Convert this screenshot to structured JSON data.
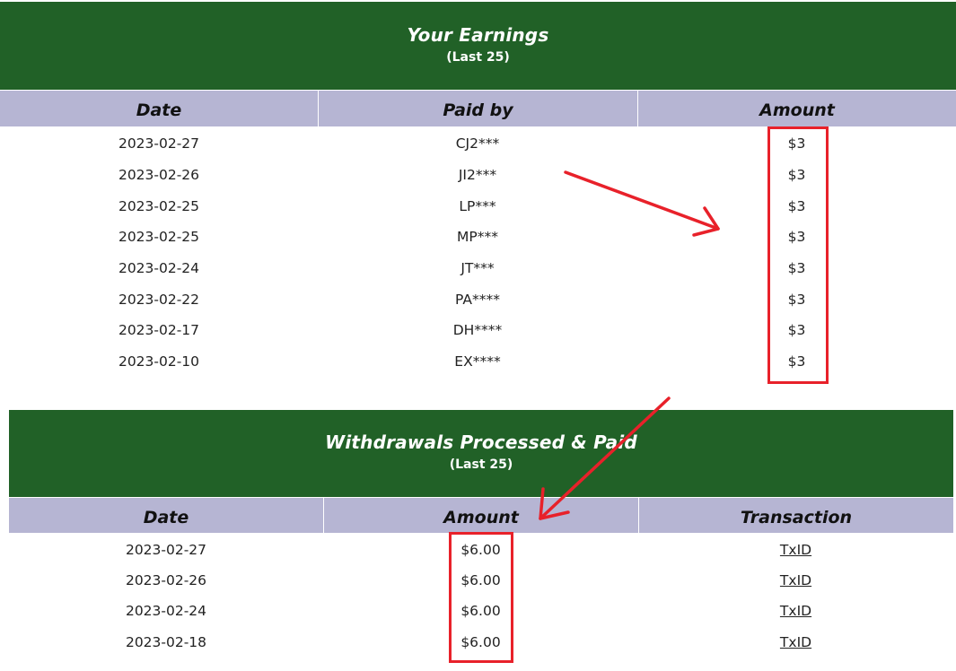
{
  "earnings": {
    "title": "Your Earnings",
    "subtitle": "(Last 25)",
    "columns": [
      "Date",
      "Paid by",
      "Amount"
    ],
    "rows": [
      {
        "date": "2023-02-27",
        "paid_by": "CJ2***",
        "amount": "$3"
      },
      {
        "date": "2023-02-26",
        "paid_by": "JI2***",
        "amount": "$3"
      },
      {
        "date": "2023-02-25",
        "paid_by": "LP***",
        "amount": "$3"
      },
      {
        "date": "2023-02-25",
        "paid_by": "MP***",
        "amount": "$3"
      },
      {
        "date": "2023-02-24",
        "paid_by": "JT***",
        "amount": "$3"
      },
      {
        "date": "2023-02-22",
        "paid_by": "PA****",
        "amount": "$3"
      },
      {
        "date": "2023-02-17",
        "paid_by": "DH****",
        "amount": "$3"
      },
      {
        "date": "2023-02-10",
        "paid_by": "EX****",
        "amount": "$3"
      }
    ]
  },
  "withdrawals": {
    "title": "Withdrawals Processed & Paid",
    "subtitle": "(Last 25)",
    "columns": [
      "Date",
      "Amount",
      "Transaction"
    ],
    "rows": [
      {
        "date": "2023-02-27",
        "amount": "$6.00",
        "transaction": "TxID"
      },
      {
        "date": "2023-02-26",
        "amount": "$6.00",
        "transaction": "TxID"
      },
      {
        "date": "2023-02-24",
        "amount": "$6.00",
        "transaction": "TxID"
      },
      {
        "date": "2023-02-18",
        "amount": "$6.00",
        "transaction": "TxID"
      }
    ]
  },
  "colors": {
    "header_green": "#216127",
    "column_header_lavender": "#b6b5d3",
    "annotation_red": "#e8212a"
  }
}
